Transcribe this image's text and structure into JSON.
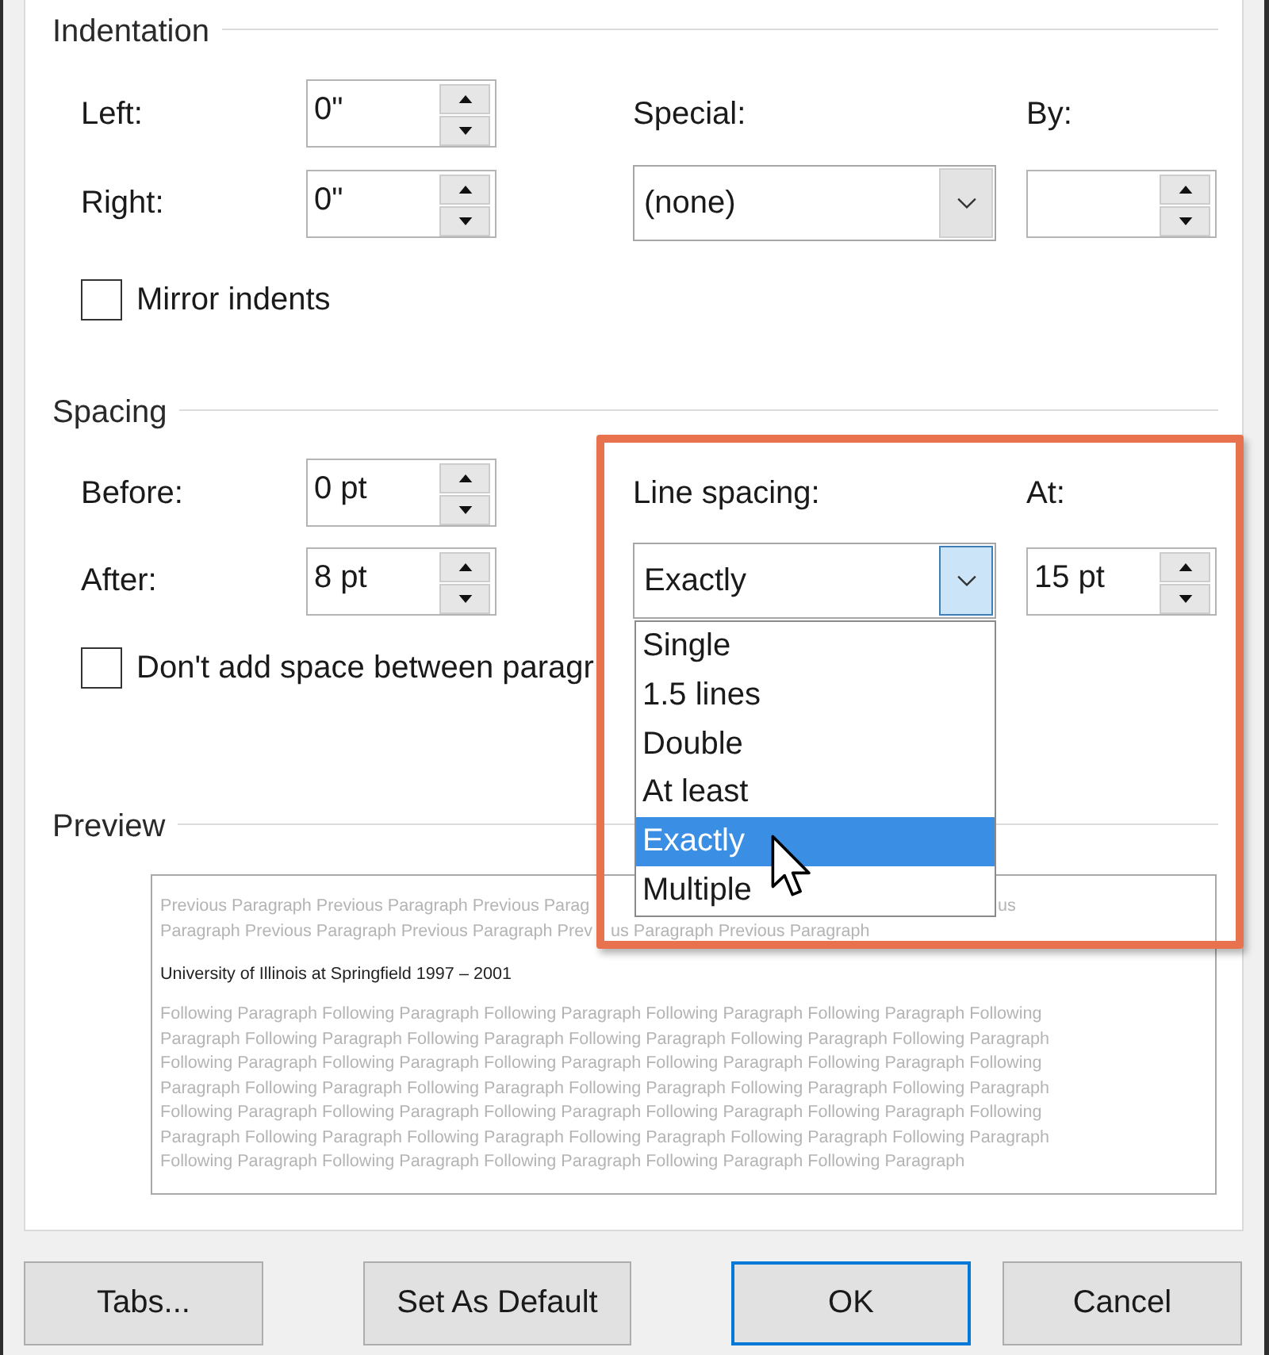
{
  "indentation": {
    "title": "Indentation",
    "left": {
      "label": "Left:",
      "value": "0\""
    },
    "right": {
      "label": "Right:",
      "value": "0\""
    },
    "special": {
      "label": "Special:",
      "value": "(none)",
      "expanded": false
    },
    "by": {
      "label": "By:"
    },
    "mirror_indents": {
      "label": "Mirror indents",
      "checked": false
    }
  },
  "spacing": {
    "title": "Spacing",
    "before": {
      "label": "Before:",
      "value": "0 pt"
    },
    "after": {
      "label": "After:",
      "value": "8 pt"
    },
    "line_spacing": {
      "label": "Line spacing:",
      "value": "Exactly",
      "expanded": true,
      "highlighted": true,
      "options": [
        {
          "label": "Single",
          "selected": false,
          "hovered": false
        },
        {
          "label": "1.5 lines",
          "selected": false,
          "hovered": false
        },
        {
          "label": "Double",
          "selected": false,
          "hovered": false
        },
        {
          "label": "At least",
          "selected": false,
          "hovered": false
        },
        {
          "label": "Exactly",
          "selected": true,
          "hovered": true
        },
        {
          "label": "Multiple",
          "selected": false,
          "hovered": false
        }
      ]
    },
    "at": {
      "label": "At:",
      "value": "15 pt"
    },
    "dont_add_space": {
      "label": "Don't add space between paragr",
      "checked": false
    }
  },
  "preview": {
    "title": "Preview",
    "preceding_lines": [
      [
        "Previous Paragraph Previous Paragraph Previous Parag",
        "us"
      ],
      [
        "Paragraph Previous Paragraph Previous Paragraph Prev",
        "us Paragraph Previous Paragraph"
      ]
    ],
    "sample": "University of Illinois at Springfield 1997 – 2001",
    "following_lines": [
      "Following Paragraph Following Paragraph Following Paragraph Following Paragraph Following Paragraph Following",
      "Paragraph Following Paragraph Following Paragraph Following Paragraph Following Paragraph Following Paragraph",
      "Following Paragraph Following Paragraph Following Paragraph Following Paragraph Following Paragraph Following",
      "Paragraph Following Paragraph Following Paragraph Following Paragraph Following Paragraph Following Paragraph",
      "Following Paragraph Following Paragraph Following Paragraph Following Paragraph Following Paragraph Following",
      "Paragraph Following Paragraph Following Paragraph Following Paragraph Following Paragraph Following Paragraph",
      "Following Paragraph Following Paragraph Following Paragraph Following Paragraph Following Paragraph"
    ]
  },
  "buttons": [
    {
      "label": "Tabs...",
      "default": false
    },
    {
      "label": "Set As Default",
      "default": false
    },
    {
      "label": "OK",
      "default": true
    },
    {
      "label": "Cancel",
      "default": false
    }
  ]
}
